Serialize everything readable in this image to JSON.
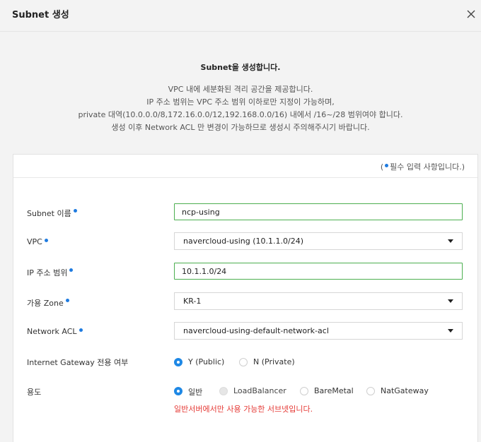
{
  "header": {
    "title": "Subnet 생성"
  },
  "intro": {
    "heading": "Subnet을 생성합니다.",
    "lines": [
      "VPC 내에 세분화된 격리 공간을 제공합니다.",
      "IP 주소 범위는 VPC 주소 범위 이하로만 지정이 가능하며,",
      "private 대역(10.0.0.0/8,172.16.0.0/12,192.168.0.0/16) 내에서 /16~/28 범위여야 합니다.",
      "생성 이후 Network ACL 만 변경이 가능하므로 생성시 주의해주시기 바랍니다."
    ]
  },
  "form": {
    "required_note_prefix": "(",
    "required_note_text": "필수 입력 사항입니다.)",
    "subnet_name": {
      "label": "Subnet 이름",
      "value": "ncp-using"
    },
    "vpc": {
      "label": "VPC",
      "value": "navercloud-using (10.1.1.0/24)"
    },
    "ip_range": {
      "label": "IP 주소 범위",
      "value": "10.1.1.0/24"
    },
    "zone": {
      "label": "가용 Zone",
      "value": "KR-1"
    },
    "network_acl": {
      "label": "Network ACL",
      "value": "navercloud-using-default-network-acl"
    },
    "internet_gateway": {
      "label": "Internet Gateway 전용 여부",
      "options": [
        "Y (Public)",
        "N (Private)"
      ],
      "selected": "Y (Public)"
    },
    "usage": {
      "label": "용도",
      "options": [
        "일반",
        "LoadBalancer",
        "BareMetal",
        "NatGateway"
      ],
      "selected": "일반",
      "warning": "일반서버에서만 사용 가능한 서브넷입니다."
    }
  },
  "colors": {
    "accent": "#1e88e5",
    "valid_border": "#4caf50",
    "warning": "#e53935"
  }
}
